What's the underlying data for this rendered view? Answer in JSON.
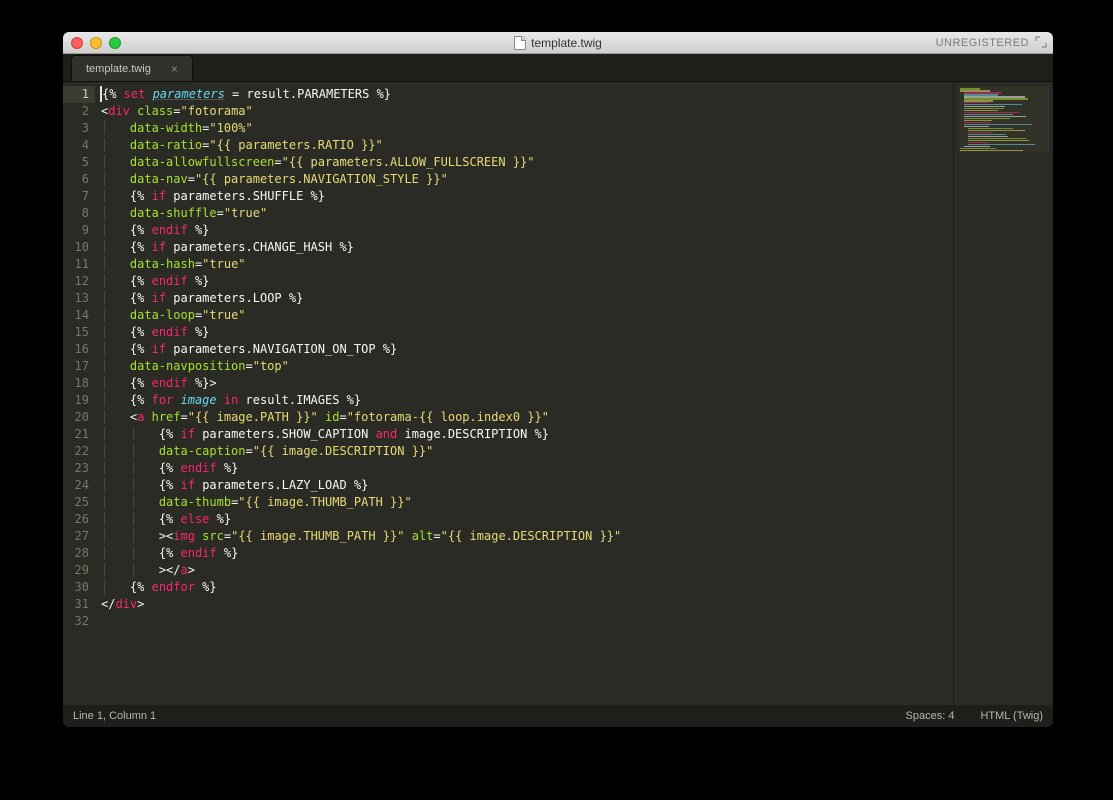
{
  "window": {
    "title": "template.twig",
    "unregistered": "UNREGISTERED"
  },
  "tab": {
    "label": "template.twig"
  },
  "status": {
    "left": "Line 1, Column 1",
    "spaces": "Spaces: 4",
    "syntax": "HTML (Twig)"
  },
  "lines": [
    1,
    2,
    3,
    4,
    5,
    6,
    7,
    8,
    9,
    10,
    11,
    12,
    13,
    14,
    15,
    16,
    17,
    18,
    19,
    20,
    21,
    22,
    23,
    24,
    25,
    26,
    27,
    28,
    29,
    30,
    31,
    32
  ],
  "code": {
    "l1": {
      "a": "{%",
      "b": " set ",
      "c": "parameters",
      "d": " = ",
      "e": "result.PARAMETERS",
      "f": " %}"
    },
    "l2": {
      "a": "<",
      "b": "div ",
      "c": "class",
      "d": "=",
      "e": "\"fotorama\""
    },
    "l3": {
      "a": "data-width",
      "b": "=",
      "c": "\"100%\""
    },
    "l4": {
      "a": "data-ratio",
      "b": "=",
      "c": "\"{{ parameters.RATIO }}\""
    },
    "l5": {
      "a": "data-allowfullscreen",
      "b": "=",
      "c": "\"{{ parameters.ALLOW_FULLSCREEN }}\""
    },
    "l6": {
      "a": "data-nav",
      "b": "=",
      "c": "\"{{ parameters.NAVIGATION_STYLE }}\""
    },
    "l7": {
      "a": "{% ",
      "b": "if ",
      "c": "parameters.SHUFFLE",
      "d": " %}"
    },
    "l8": {
      "a": "data-shuffle",
      "b": "=",
      "c": "\"true\""
    },
    "l9": {
      "a": "{% ",
      "b": "endif",
      "c": " %}"
    },
    "l10": {
      "a": "{% ",
      "b": "if ",
      "c": "parameters.CHANGE_HASH",
      "d": " %}"
    },
    "l11": {
      "a": "data-hash",
      "b": "=",
      "c": "\"true\""
    },
    "l12": {
      "a": "{% ",
      "b": "endif",
      "c": " %}"
    },
    "l13": {
      "a": "{% ",
      "b": "if ",
      "c": "parameters.LOOP",
      "d": " %}"
    },
    "l14": {
      "a": "data-loop",
      "b": "=",
      "c": "\"true\""
    },
    "l15": {
      "a": "{% ",
      "b": "endif",
      "c": " %}"
    },
    "l16": {
      "a": "{% ",
      "b": "if ",
      "c": "parameters.NAVIGATION_ON_TOP",
      "d": " %}"
    },
    "l17": {
      "a": "data-navposition",
      "b": "=",
      "c": "\"top\""
    },
    "l18": {
      "a": "{% ",
      "b": "endif",
      "c": " %}",
      "d": ">"
    },
    "l19": {
      "a": "{% ",
      "b": "for ",
      "c": "image",
      "d": " in ",
      "e": "result.IMAGES",
      "f": " %}"
    },
    "l20": {
      "a": "<",
      "b": "a ",
      "c": "href",
      "d": "=",
      "e": "\"{{ image.PATH }}\" ",
      "f": "id",
      "g": "=",
      "h": "\"fotorama-{{ loop.index0 }}\""
    },
    "l21": {
      "a": "{% ",
      "b": "if ",
      "c": "parameters.SHOW_CAPTION",
      "d": " and ",
      "e": "image.DESCRIPTION",
      "f": " %}"
    },
    "l22": {
      "a": "data-caption",
      "b": "=",
      "c": "\"{{ image.DESCRIPTION }}\""
    },
    "l23": {
      "a": "{% ",
      "b": "endif",
      "c": " %}"
    },
    "l24": {
      "a": "{% ",
      "b": "if ",
      "c": "parameters.LAZY_LOAD",
      "d": " %}"
    },
    "l25": {
      "a": "data-thumb",
      "b": "=",
      "c": "\"{{ image.THUMB_PATH }}\""
    },
    "l26": {
      "a": "{% ",
      "b": "else",
      "c": " %}"
    },
    "l27": {
      "a": "><",
      "b": "img ",
      "c": "src",
      "d": "=",
      "e": "\"{{ image.THUMB_PATH }}\" ",
      "f": "alt",
      "g": "=",
      "h": "\"{{ image.DESCRIPTION }}\""
    },
    "l28": {
      "a": "{% ",
      "b": "endif",
      "c": " %}"
    },
    "l29": {
      "a": "></",
      "b": "a",
      "c": ">"
    },
    "l30": {
      "a": "{% ",
      "b": "endfor",
      "c": " %}"
    },
    "l31": {
      "a": "</",
      "b": "div",
      "c": ">"
    }
  }
}
